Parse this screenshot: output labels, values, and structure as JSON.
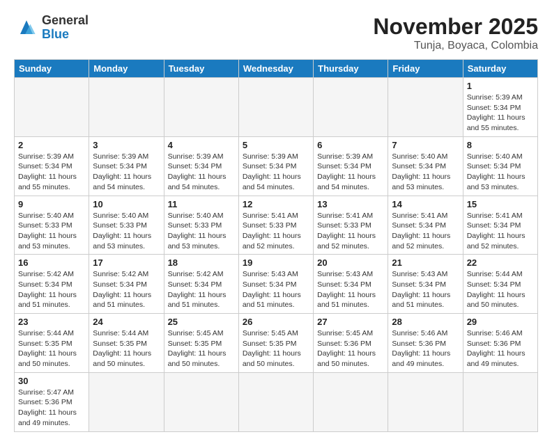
{
  "header": {
    "logo_general": "General",
    "logo_blue": "Blue",
    "month": "November 2025",
    "location": "Tunja, Boyaca, Colombia"
  },
  "days_of_week": [
    "Sunday",
    "Monday",
    "Tuesday",
    "Wednesday",
    "Thursday",
    "Friday",
    "Saturday"
  ],
  "weeks": [
    [
      {
        "day": "",
        "info": ""
      },
      {
        "day": "",
        "info": ""
      },
      {
        "day": "",
        "info": ""
      },
      {
        "day": "",
        "info": ""
      },
      {
        "day": "",
        "info": ""
      },
      {
        "day": "",
        "info": ""
      },
      {
        "day": "1",
        "info": "Sunrise: 5:39 AM\nSunset: 5:34 PM\nDaylight: 11 hours\nand 55 minutes."
      }
    ],
    [
      {
        "day": "2",
        "info": "Sunrise: 5:39 AM\nSunset: 5:34 PM\nDaylight: 11 hours\nand 55 minutes."
      },
      {
        "day": "3",
        "info": "Sunrise: 5:39 AM\nSunset: 5:34 PM\nDaylight: 11 hours\nand 54 minutes."
      },
      {
        "day": "4",
        "info": "Sunrise: 5:39 AM\nSunset: 5:34 PM\nDaylight: 11 hours\nand 54 minutes."
      },
      {
        "day": "5",
        "info": "Sunrise: 5:39 AM\nSunset: 5:34 PM\nDaylight: 11 hours\nand 54 minutes."
      },
      {
        "day": "6",
        "info": "Sunrise: 5:39 AM\nSunset: 5:34 PM\nDaylight: 11 hours\nand 54 minutes."
      },
      {
        "day": "7",
        "info": "Sunrise: 5:40 AM\nSunset: 5:34 PM\nDaylight: 11 hours\nand 53 minutes."
      },
      {
        "day": "8",
        "info": "Sunrise: 5:40 AM\nSunset: 5:34 PM\nDaylight: 11 hours\nand 53 minutes."
      }
    ],
    [
      {
        "day": "9",
        "info": "Sunrise: 5:40 AM\nSunset: 5:33 PM\nDaylight: 11 hours\nand 53 minutes."
      },
      {
        "day": "10",
        "info": "Sunrise: 5:40 AM\nSunset: 5:33 PM\nDaylight: 11 hours\nand 53 minutes."
      },
      {
        "day": "11",
        "info": "Sunrise: 5:40 AM\nSunset: 5:33 PM\nDaylight: 11 hours\nand 53 minutes."
      },
      {
        "day": "12",
        "info": "Sunrise: 5:41 AM\nSunset: 5:33 PM\nDaylight: 11 hours\nand 52 minutes."
      },
      {
        "day": "13",
        "info": "Sunrise: 5:41 AM\nSunset: 5:33 PM\nDaylight: 11 hours\nand 52 minutes."
      },
      {
        "day": "14",
        "info": "Sunrise: 5:41 AM\nSunset: 5:34 PM\nDaylight: 11 hours\nand 52 minutes."
      },
      {
        "day": "15",
        "info": "Sunrise: 5:41 AM\nSunset: 5:34 PM\nDaylight: 11 hours\nand 52 minutes."
      }
    ],
    [
      {
        "day": "16",
        "info": "Sunrise: 5:42 AM\nSunset: 5:34 PM\nDaylight: 11 hours\nand 51 minutes."
      },
      {
        "day": "17",
        "info": "Sunrise: 5:42 AM\nSunset: 5:34 PM\nDaylight: 11 hours\nand 51 minutes."
      },
      {
        "day": "18",
        "info": "Sunrise: 5:42 AM\nSunset: 5:34 PM\nDaylight: 11 hours\nand 51 minutes."
      },
      {
        "day": "19",
        "info": "Sunrise: 5:43 AM\nSunset: 5:34 PM\nDaylight: 11 hours\nand 51 minutes."
      },
      {
        "day": "20",
        "info": "Sunrise: 5:43 AM\nSunset: 5:34 PM\nDaylight: 11 hours\nand 51 minutes."
      },
      {
        "day": "21",
        "info": "Sunrise: 5:43 AM\nSunset: 5:34 PM\nDaylight: 11 hours\nand 51 minutes."
      },
      {
        "day": "22",
        "info": "Sunrise: 5:44 AM\nSunset: 5:34 PM\nDaylight: 11 hours\nand 50 minutes."
      }
    ],
    [
      {
        "day": "23",
        "info": "Sunrise: 5:44 AM\nSunset: 5:35 PM\nDaylight: 11 hours\nand 50 minutes."
      },
      {
        "day": "24",
        "info": "Sunrise: 5:44 AM\nSunset: 5:35 PM\nDaylight: 11 hours\nand 50 minutes."
      },
      {
        "day": "25",
        "info": "Sunrise: 5:45 AM\nSunset: 5:35 PM\nDaylight: 11 hours\nand 50 minutes."
      },
      {
        "day": "26",
        "info": "Sunrise: 5:45 AM\nSunset: 5:35 PM\nDaylight: 11 hours\nand 50 minutes."
      },
      {
        "day": "27",
        "info": "Sunrise: 5:45 AM\nSunset: 5:36 PM\nDaylight: 11 hours\nand 50 minutes."
      },
      {
        "day": "28",
        "info": "Sunrise: 5:46 AM\nSunset: 5:36 PM\nDaylight: 11 hours\nand 49 minutes."
      },
      {
        "day": "29",
        "info": "Sunrise: 5:46 AM\nSunset: 5:36 PM\nDaylight: 11 hours\nand 49 minutes."
      }
    ],
    [
      {
        "day": "30",
        "info": "Sunrise: 5:47 AM\nSunset: 5:36 PM\nDaylight: 11 hours\nand 49 minutes."
      },
      {
        "day": "",
        "info": ""
      },
      {
        "day": "",
        "info": ""
      },
      {
        "day": "",
        "info": ""
      },
      {
        "day": "",
        "info": ""
      },
      {
        "day": "",
        "info": ""
      },
      {
        "day": "",
        "info": ""
      }
    ]
  ]
}
